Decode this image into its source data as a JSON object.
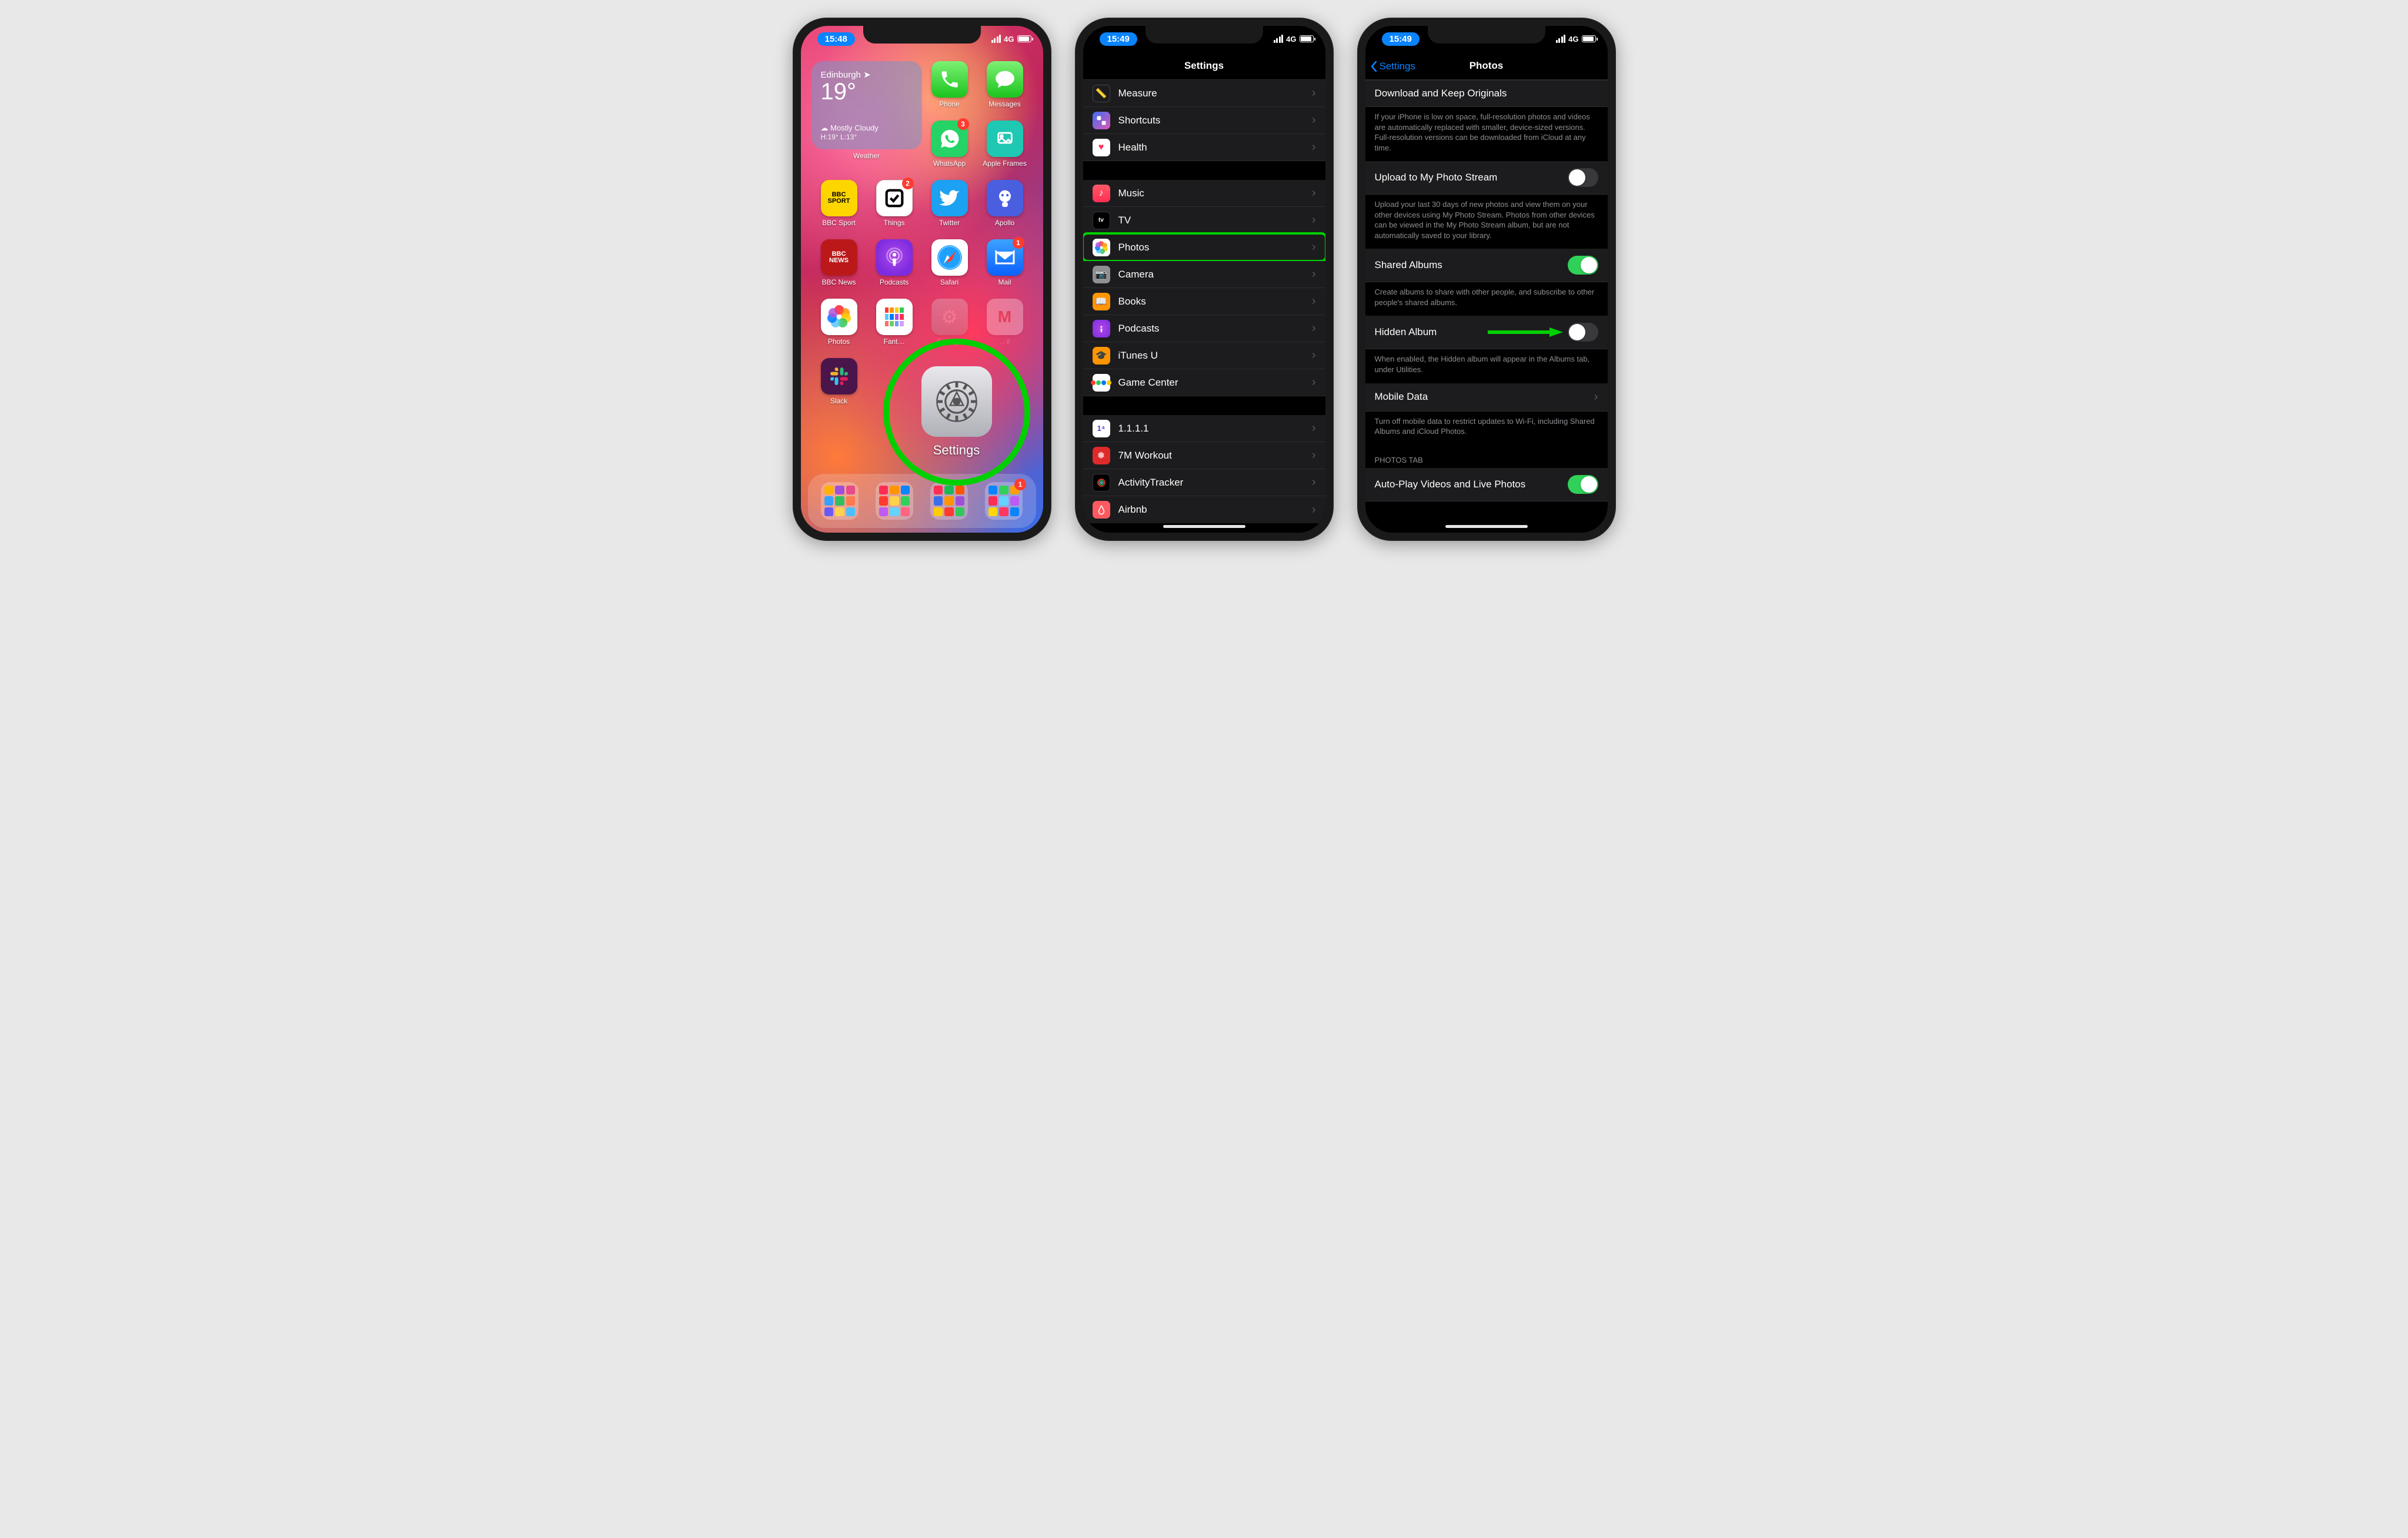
{
  "status": {
    "time1": "15:48",
    "time2": "15:49",
    "time3": "15:49",
    "network": "4G"
  },
  "home": {
    "weather": {
      "city": "Edinburgh",
      "temp": "19°",
      "condition": "Mostly Cloudy",
      "hilo": "H:19° L:13°",
      "widget_label": "Weather"
    },
    "apps": {
      "phone": "Phone",
      "messages": "Messages",
      "whatsapp": "WhatsApp",
      "appleframes": "Apple Frames",
      "bbcsport": "BBC Sport",
      "things": "Things",
      "twitter": "Twitter",
      "apollo": "Apollo",
      "bbcnews": "BBC News",
      "podcasts": "Podcasts",
      "safari": "Safari",
      "mail": "Mail",
      "photos": "Photos",
      "fantastical": "Fant…",
      "settings": "Settings",
      "gmail": "…il",
      "slack": "Slack"
    },
    "badges": {
      "whatsapp": "3",
      "things": "2",
      "mail": "1",
      "dock4": "1"
    },
    "magnify_label": "Settings"
  },
  "settings": {
    "title": "Settings",
    "rows": {
      "measure": "Measure",
      "shortcuts": "Shortcuts",
      "health": "Health",
      "music": "Music",
      "tv": "TV",
      "photos": "Photos",
      "camera": "Camera",
      "books": "Books",
      "podcasts": "Podcasts",
      "itunesu": "iTunes U",
      "gamecenter": "Game Center",
      "r1111": "1.1.1.1",
      "r7m": "7M Workout",
      "ract": "ActivityTracker",
      "rairbnb": "Airbnb"
    }
  },
  "photosSettings": {
    "back": "Settings",
    "title": "Photos",
    "download": "Download and Keep Originals",
    "download_desc": "If your iPhone is low on space, full-resolution photos and videos are automatically replaced with smaller, device-sized versions. Full-resolution versions can be downloaded from iCloud at any time.",
    "upload": "Upload to My Photo Stream",
    "upload_desc": "Upload your last 30 days of new photos and view them on your other devices using My Photo Stream. Photos from other devices can be viewed in the My Photo Stream album, but are not automatically saved to your library.",
    "shared": "Shared Albums",
    "shared_desc": "Create albums to share with other people, and subscribe to other people's shared albums.",
    "hidden": "Hidden Album",
    "hidden_desc": "When enabled, the Hidden album will appear in the Albums tab, under Utilities.",
    "mobile": "Mobile Data",
    "mobile_desc": "Turn off mobile data to restrict updates to Wi-Fi, including Shared Albums and iCloud Photos.",
    "photostab_header": "PHOTOS TAB",
    "autoplay": "Auto-Play Videos and Live Photos"
  }
}
